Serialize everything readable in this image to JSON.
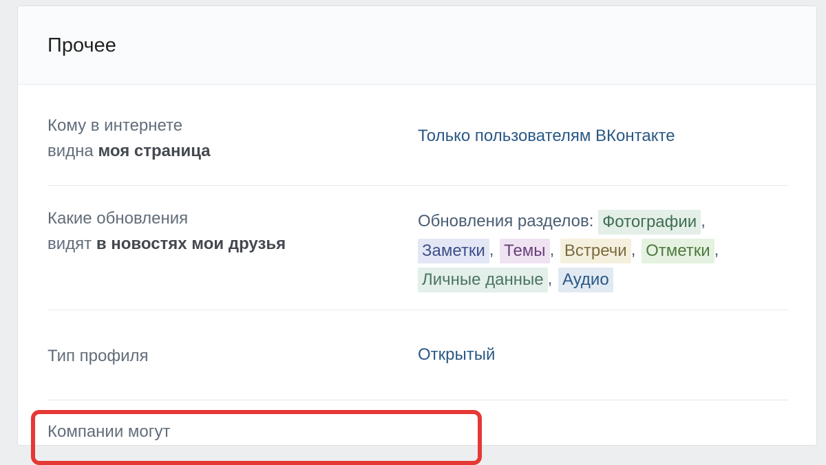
{
  "section": {
    "title": "Прочее"
  },
  "rows": {
    "visibility": {
      "label_line1": "Кому в интернете",
      "label_line2_normal": "видна ",
      "label_line2_bold": "моя страница",
      "value": "Только пользователям ВКонтакте"
    },
    "updates": {
      "label_line1": "Какие обновления",
      "label_line2_normal": "видят ",
      "label_line2_bold": "в новостях мои друзья",
      "value_prefix": "Обновления разделов:",
      "chips": [
        "Фотографии",
        "Заметки",
        "Темы",
        "Встречи",
        "Отметки",
        "Личные данные",
        "Аудио"
      ]
    },
    "profile_type": {
      "label": "Тип профиля",
      "value": "Открытый"
    },
    "companies": {
      "label_partial": "Компании могут"
    }
  },
  "colors": {
    "link": "#2a5885",
    "highlight": "#e53935"
  }
}
